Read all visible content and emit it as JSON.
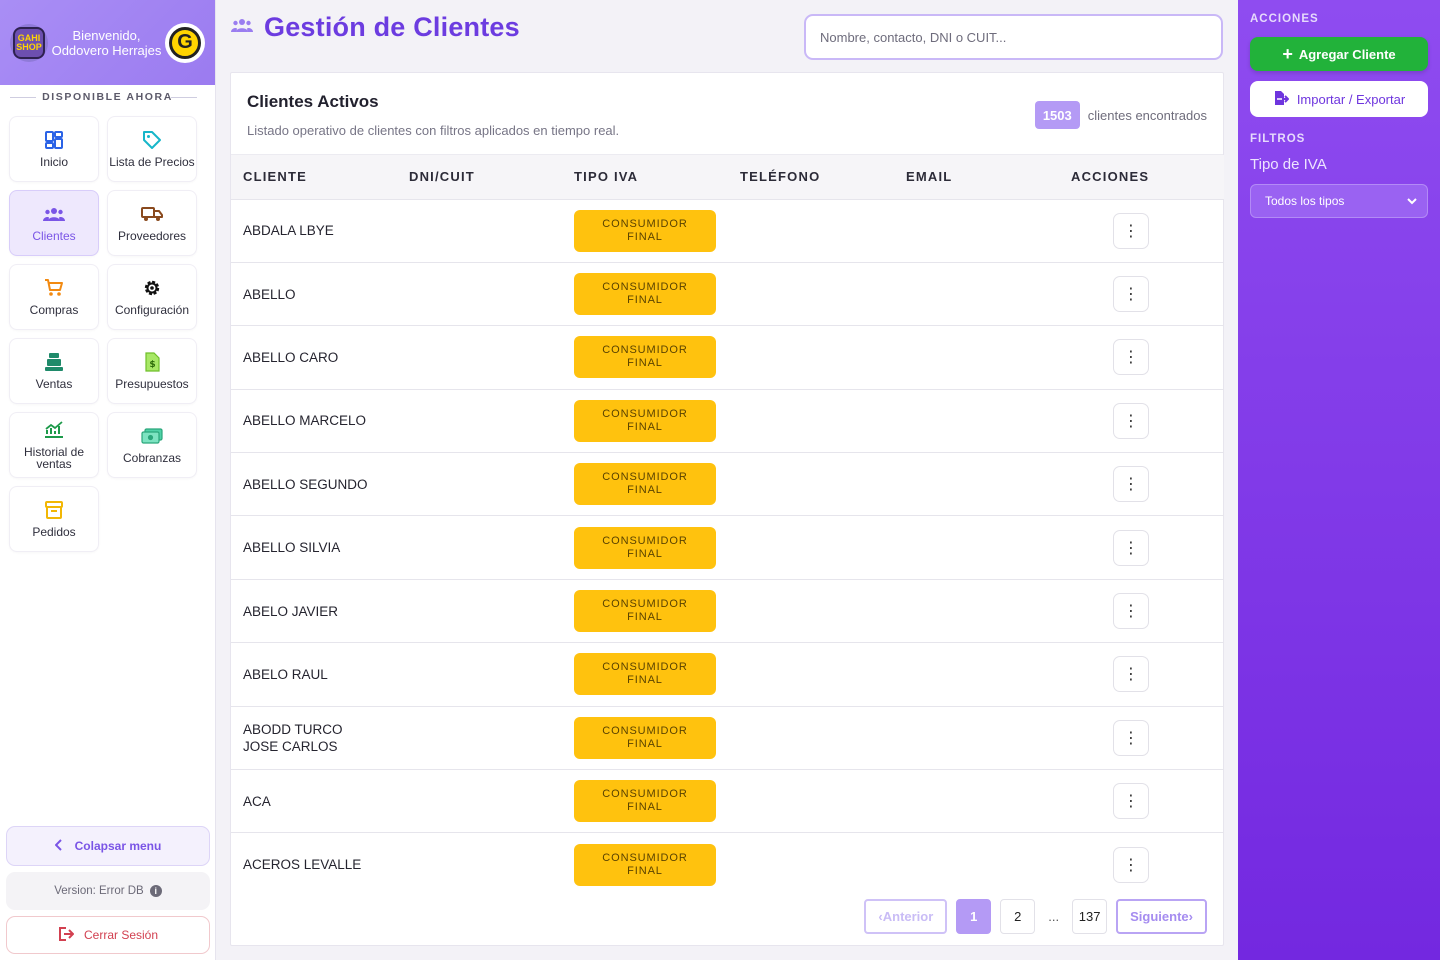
{
  "sidebar": {
    "logo_text": "GAHI SHOP",
    "welcome": "Bienvenido, Oddovero Herrajes",
    "avatar_letter": "G",
    "section_title": "DISPONIBLE AHORA",
    "items": [
      {
        "label": "Inicio",
        "icon": "dashboard-icon",
        "active": false
      },
      {
        "label": "Lista de Precios",
        "icon": "tag-icon",
        "active": false
      },
      {
        "label": "Clientes",
        "icon": "users-icon",
        "active": true
      },
      {
        "label": "Proveedores",
        "icon": "truck-icon",
        "active": false
      },
      {
        "label": "Compras",
        "icon": "cart-icon",
        "active": false
      },
      {
        "label": "Configuración",
        "icon": "gear-icon",
        "active": false
      },
      {
        "label": "Ventas",
        "icon": "cash-register-icon",
        "active": false
      },
      {
        "label": "Presupuestos",
        "icon": "document-icon",
        "active": false
      },
      {
        "label": "Historial de ventas",
        "icon": "chart-line-icon",
        "active": false
      },
      {
        "label": "Cobranzas",
        "icon": "money-icon",
        "active": false
      },
      {
        "label": "Pedidos",
        "icon": "box-icon",
        "active": false
      }
    ],
    "collapse_label": "Colapsar menu",
    "version_label": "Version: Error DB",
    "logout_label": "Cerrar Sesión"
  },
  "header": {
    "title": "Gestión de Clientes",
    "search_placeholder": "Nombre, contacto, DNI o CUIT..."
  },
  "card": {
    "title": "Clientes Activos",
    "subtitle": "Listado operativo de clientes con filtros aplicados en tiempo real.",
    "count": "1503",
    "count_label": "clientes encontrados"
  },
  "table": {
    "columns": [
      "CLIENTE",
      "DNI/CUIT",
      "TIPO IVA",
      "TELÉFONO",
      "EMAIL",
      "ACCIONES"
    ],
    "rows": [
      {
        "cliente": "ABDALA LBYE",
        "dni": "",
        "iva": "CONSUMIDOR FINAL",
        "telefono": "",
        "email": ""
      },
      {
        "cliente": "ABELLO",
        "dni": "",
        "iva": "CONSUMIDOR FINAL",
        "telefono": "",
        "email": ""
      },
      {
        "cliente": "ABELLO CARO",
        "dni": "",
        "iva": "CONSUMIDOR FINAL",
        "telefono": "",
        "email": ""
      },
      {
        "cliente": "ABELLO MARCELO",
        "dni": "",
        "iva": "CONSUMIDOR FINAL",
        "telefono": "",
        "email": ""
      },
      {
        "cliente": "ABELLO SEGUNDO",
        "dni": "",
        "iva": "CONSUMIDOR FINAL",
        "telefono": "",
        "email": ""
      },
      {
        "cliente": "ABELLO SILVIA",
        "dni": "",
        "iva": "CONSUMIDOR FINAL",
        "telefono": "",
        "email": ""
      },
      {
        "cliente": "ABELO JAVIER",
        "dni": "",
        "iva": "CONSUMIDOR FINAL",
        "telefono": "",
        "email": ""
      },
      {
        "cliente": "ABELO RAUL",
        "dni": "",
        "iva": "CONSUMIDOR FINAL",
        "telefono": "",
        "email": ""
      },
      {
        "cliente": "ABODD TURCO JOSE CARLOS",
        "dni": "",
        "iva": "CONSUMIDOR FINAL",
        "telefono": "",
        "email": ""
      },
      {
        "cliente": "ACA",
        "dni": "",
        "iva": "CONSUMIDOR FINAL",
        "telefono": "",
        "email": ""
      },
      {
        "cliente": "ACEROS LEVALLE",
        "dni": "",
        "iva": "CONSUMIDOR FINAL",
        "telefono": "",
        "email": ""
      }
    ]
  },
  "pagination": {
    "prev_label": "Anterior",
    "next_label": "Siguiente",
    "pages": [
      "1",
      "2",
      "...",
      "137"
    ],
    "current": "1"
  },
  "right_panel": {
    "actions_title": "ACCIONES",
    "add_label": "Agregar Cliente",
    "import_label": "Importar / Exportar",
    "filters_title": "FILTROS",
    "iva_filter_label": "Tipo de IVA",
    "iva_filter_value": "Todos los tipos"
  },
  "colors": {
    "brand_purple": "#6c3ce0",
    "accent_lilac": "#b49af5",
    "iva_badge": "#ffc20e",
    "add_green": "#22b23a",
    "logout_red": "#d24050"
  }
}
